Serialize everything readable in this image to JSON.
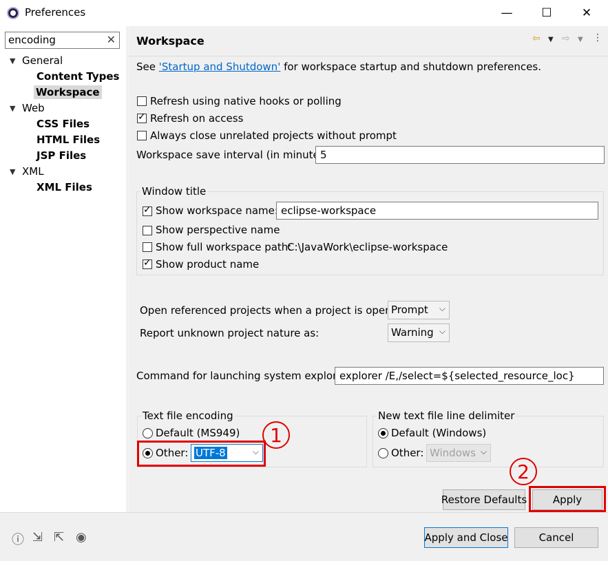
{
  "window": {
    "title": "Preferences",
    "minimize_glyph": "—",
    "maximize_glyph": "☐",
    "close_glyph": "✕"
  },
  "filter": {
    "value": "encoding",
    "clear_glyph": "✕"
  },
  "tree": {
    "items": [
      {
        "label": "General",
        "expanded": true
      },
      {
        "label": "Content Types"
      },
      {
        "label": "Workspace",
        "selected": true
      },
      {
        "label": "Web",
        "expanded": true
      },
      {
        "label": "CSS Files"
      },
      {
        "label": "HTML Files"
      },
      {
        "label": "JSP Files"
      },
      {
        "label": "XML",
        "expanded": true
      },
      {
        "label": "XML Files"
      }
    ]
  },
  "page": {
    "title": "Workspace",
    "intro_prefix": "See ",
    "intro_link": "'Startup and Shutdown'",
    "intro_suffix": " for workspace startup and shutdown preferences.",
    "options": {
      "refresh_native": "Refresh using native hooks or polling",
      "refresh_access": "Refresh on access",
      "always_close": "Always close unrelated projects without prompt"
    },
    "save_interval": {
      "label": "Workspace save interval (in minutes):",
      "value": "5"
    },
    "window_title_group": {
      "title": "Window title",
      "show_workspace_name": "Show workspace name:",
      "workspace_name_value": "eclipse-workspace",
      "show_perspective_name": "Show perspective name",
      "show_full_path": "Show full workspace path:",
      "full_path_value": "C:\\JavaWork\\eclipse-workspace",
      "show_product_name": "Show product name"
    },
    "open_referenced": {
      "label": "Open referenced projects when a project is opened:",
      "value": "Prompt"
    },
    "report_unknown": {
      "label": "Report unknown project nature as:",
      "value": "Warning"
    },
    "system_explorer": {
      "label": "Command for launching system explorer:",
      "value": "explorer /E,/select=${selected_resource_loc}"
    },
    "text_encoding": {
      "title": "Text file encoding",
      "default_label": "Default (MS949)",
      "other_label": "Other:",
      "other_value": "UTF-8"
    },
    "line_delimiter": {
      "title": "New text file line delimiter",
      "default_label": "Default (Windows)",
      "other_label": "Other:",
      "other_value": "Windows"
    },
    "restore_defaults": "Restore Defaults",
    "apply": "Apply"
  },
  "annotations": {
    "callout_1": "1",
    "callout_2": "2",
    "color": "#e00000"
  },
  "footer": {
    "apply_and_close": "Apply and Close",
    "cancel": "Cancel",
    "icons": [
      "help-icon",
      "import-icon",
      "export-icon",
      "record-icon"
    ]
  }
}
